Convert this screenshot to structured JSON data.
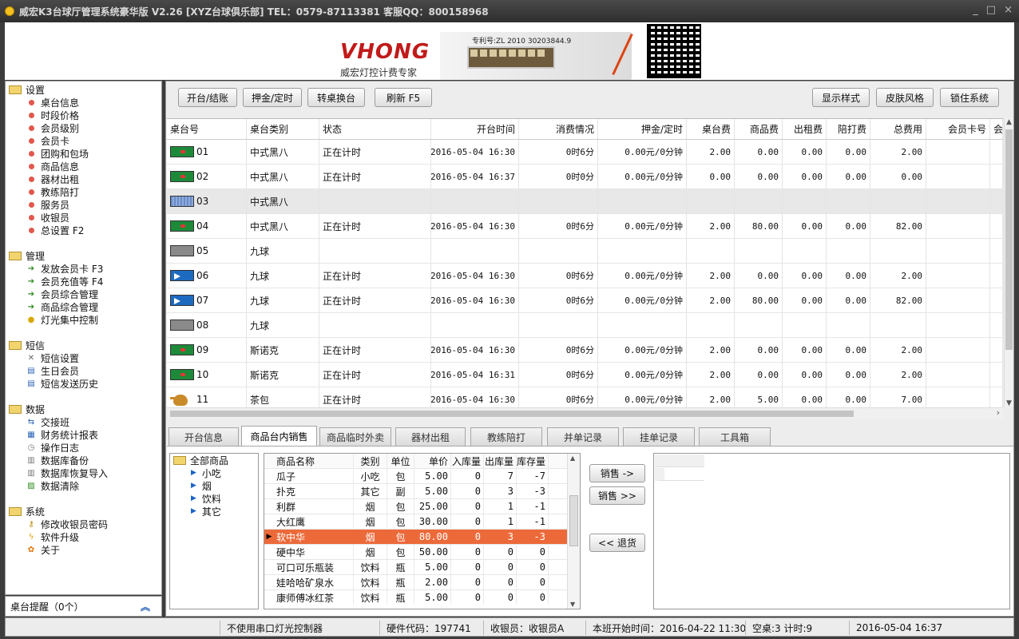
{
  "window": {
    "title": "威宏K3台球厅管理系统豪华版 V2.26   [XYZ台球俱乐部]   TEL：0579-87113381 客服QQ：800158968",
    "controls": [
      "_",
      "□",
      "×"
    ]
  },
  "banner": {
    "brand": "VHONG",
    "slogan": "威宏灯控计费专家",
    "patent": "专利号:ZL 2010 30203844.9"
  },
  "sidebar": {
    "groups": [
      {
        "title": "设置",
        "items": [
          {
            "label": "桌台信息",
            "icon": "dot-icon"
          },
          {
            "label": "时段价格",
            "icon": "dot-icon"
          },
          {
            "label": "会员级别",
            "icon": "dot-icon"
          },
          {
            "label": "会员卡",
            "icon": "dot-icon"
          },
          {
            "label": "团购和包场",
            "icon": "dot-icon"
          },
          {
            "label": "商品信息",
            "icon": "dot-icon"
          },
          {
            "label": "器材出租",
            "icon": "dot-icon"
          },
          {
            "label": "教练陪打",
            "icon": "dot-icon"
          },
          {
            "label": "服务员",
            "icon": "dot-icon"
          },
          {
            "label": "收银员",
            "icon": "dot-icon"
          },
          {
            "label": "总设置 F2",
            "icon": "dot-icon"
          }
        ]
      },
      {
        "title": "管理",
        "items": [
          {
            "label": "发放会员卡 F3",
            "icon": "arrow-icon"
          },
          {
            "label": "会员充值等 F4",
            "icon": "arrow-icon"
          },
          {
            "label": "会员综合管理",
            "icon": "arrow-icon"
          },
          {
            "label": "商品综合管理",
            "icon": "arrow-icon"
          },
          {
            "label": "灯光集中控制",
            "icon": "bulb-icon"
          }
        ]
      },
      {
        "title": "短信",
        "items": [
          {
            "label": "短信设置",
            "icon": "tools-icon"
          },
          {
            "label": "生日会员",
            "icon": "sms-icon"
          },
          {
            "label": "短信发送历史",
            "icon": "sms-icon"
          }
        ]
      },
      {
        "title": "数据",
        "items": [
          {
            "label": "交接班",
            "icon": "handover-icon"
          },
          {
            "label": "财务统计报表",
            "icon": "report-icon"
          },
          {
            "label": "操作日志",
            "icon": "clock-icon"
          },
          {
            "label": "数据库备份",
            "icon": "database-icon"
          },
          {
            "label": "数据库恢复导入",
            "icon": "database-icon"
          },
          {
            "label": "数据清除",
            "icon": "trash-icon"
          }
        ]
      },
      {
        "title": "系统",
        "items": [
          {
            "label": "修改收银员密码",
            "icon": "key-icon"
          },
          {
            "label": "软件升级",
            "icon": "bolt-icon"
          },
          {
            "label": "关于",
            "icon": "flower-icon"
          }
        ]
      }
    ],
    "reminder": "桌台提醒（0个）"
  },
  "toolbar": {
    "open_close": "开台/结账",
    "deposit": "押金/定时",
    "switch_table": "转桌换台",
    "refresh": "刷新 F5",
    "display_style": "显示样式",
    "skin": "皮肤风格",
    "lock": "锁住系统"
  },
  "tables": {
    "columns": [
      "桌台号",
      "桌台类别",
      "状态",
      "开台时间",
      "消费情况",
      "押金/定时",
      "桌台费",
      "商品费",
      "出租费",
      "陪打费",
      "总费用",
      "会员卡号",
      "会"
    ],
    "rows": [
      {
        "icon": "green",
        "no": "01",
        "type": "中式黑八",
        "status": "正在计时",
        "start": "2016-05-04 16:30",
        "usage": "0时6分",
        "deposit": "0.00元/0分钟",
        "table_fee": "2.00",
        "goods_fee": "0.00",
        "rent_fee": "0.00",
        "coach_fee": "0.00",
        "total": "2.00",
        "card": ""
      },
      {
        "icon": "green",
        "no": "02",
        "type": "中式黑八",
        "status": "正在计时",
        "start": "2016-05-04 16:37",
        "usage": "0时0分",
        "deposit": "0.00元/0分钟",
        "table_fee": "0.00",
        "goods_fee": "0.00",
        "rent_fee": "0.00",
        "coach_fee": "0.00",
        "total": "0.00",
        "card": ""
      },
      {
        "icon": "idle",
        "no": "03",
        "type": "中式黑八",
        "status": "",
        "start": "",
        "usage": "",
        "deposit": "",
        "table_fee": "",
        "goods_fee": "",
        "rent_fee": "",
        "coach_fee": "",
        "total": "",
        "card": ""
      },
      {
        "icon": "green",
        "no": "04",
        "type": "中式黑八",
        "status": "正在计时",
        "start": "2016-05-04 16:30",
        "usage": "0时6分",
        "deposit": "0.00元/0分钟",
        "table_fee": "2.00",
        "goods_fee": "80.00",
        "rent_fee": "0.00",
        "coach_fee": "0.00",
        "total": "82.00",
        "card": ""
      },
      {
        "icon": "grey",
        "no": "05",
        "type": "九球",
        "status": "",
        "start": "",
        "usage": "",
        "deposit": "",
        "table_fee": "",
        "goods_fee": "",
        "rent_fee": "",
        "coach_fee": "",
        "total": "",
        "card": ""
      },
      {
        "icon": "blue",
        "no": "06",
        "type": "九球",
        "status": "正在计时",
        "start": "2016-05-04 16:30",
        "usage": "0时6分",
        "deposit": "0.00元/0分钟",
        "table_fee": "2.00",
        "goods_fee": "0.00",
        "rent_fee": "0.00",
        "coach_fee": "0.00",
        "total": "2.00",
        "card": ""
      },
      {
        "icon": "blue",
        "no": "07",
        "type": "九球",
        "status": "正在计时",
        "start": "2016-05-04 16:30",
        "usage": "0时6分",
        "deposit": "0.00元/0分钟",
        "table_fee": "2.00",
        "goods_fee": "80.00",
        "rent_fee": "0.00",
        "coach_fee": "0.00",
        "total": "82.00",
        "card": ""
      },
      {
        "icon": "grey",
        "no": "08",
        "type": "九球",
        "status": "",
        "start": "",
        "usage": "",
        "deposit": "",
        "table_fee": "",
        "goods_fee": "",
        "rent_fee": "",
        "coach_fee": "",
        "total": "",
        "card": ""
      },
      {
        "icon": "green",
        "no": "09",
        "type": "斯诺克",
        "status": "正在计时",
        "start": "2016-05-04 16:30",
        "usage": "0时6分",
        "deposit": "0.00元/0分钟",
        "table_fee": "2.00",
        "goods_fee": "0.00",
        "rent_fee": "0.00",
        "coach_fee": "0.00",
        "total": "2.00",
        "card": ""
      },
      {
        "icon": "green",
        "no": "10",
        "type": "斯诺克",
        "status": "正在计时",
        "start": "2016-05-04 16:31",
        "usage": "0时6分",
        "deposit": "0.00元/0分钟",
        "table_fee": "2.00",
        "goods_fee": "0.00",
        "rent_fee": "0.00",
        "coach_fee": "0.00",
        "total": "2.00",
        "card": ""
      },
      {
        "icon": "teapot",
        "no": "11",
        "type": "茶包",
        "status": "正在计时",
        "start": "2016-05-04 16:30",
        "usage": "0时6分",
        "deposit": "0.00元/0分钟",
        "table_fee": "2.00",
        "goods_fee": "5.00",
        "rent_fee": "0.00",
        "coach_fee": "0.00",
        "total": "7.00",
        "card": ""
      }
    ],
    "selected_index": 2
  },
  "tabs": [
    {
      "label": "开台信息",
      "active": false
    },
    {
      "label": "商品台内销售",
      "active": true
    },
    {
      "label": "商品临时外卖",
      "active": false
    },
    {
      "label": "器材出租",
      "active": false
    },
    {
      "label": "教练陪打",
      "active": false
    },
    {
      "label": "并单记录",
      "active": false
    },
    {
      "label": "挂单记录",
      "active": false
    },
    {
      "label": "工具箱",
      "active": false
    }
  ],
  "categories": {
    "root": "全部商品",
    "items": [
      "小吃",
      "烟",
      "饮料",
      "其它"
    ]
  },
  "products": {
    "columns": [
      "商品名称",
      "类别",
      "单位",
      "单价",
      "入库量",
      "出库量",
      "库存量"
    ],
    "rows": [
      {
        "name": "瓜子",
        "cat": "小吃",
        "unit": "包",
        "price": "5.00",
        "in": "0",
        "out": "7",
        "stock": "-7"
      },
      {
        "name": "扑克",
        "cat": "其它",
        "unit": "副",
        "price": "5.00",
        "in": "0",
        "out": "3",
        "stock": "-3"
      },
      {
        "name": "利群",
        "cat": "烟",
        "unit": "包",
        "price": "25.00",
        "in": "0",
        "out": "1",
        "stock": "-1"
      },
      {
        "name": "大红鹰",
        "cat": "烟",
        "unit": "包",
        "price": "30.00",
        "in": "0",
        "out": "1",
        "stock": "-1"
      },
      {
        "name": "软中华",
        "cat": "烟",
        "unit": "包",
        "price": "80.00",
        "in": "0",
        "out": "3",
        "stock": "-3"
      },
      {
        "name": "硬中华",
        "cat": "烟",
        "unit": "包",
        "price": "50.00",
        "in": "0",
        "out": "0",
        "stock": "0"
      },
      {
        "name": "可口可乐瓶装",
        "cat": "饮料",
        "unit": "瓶",
        "price": "5.00",
        "in": "0",
        "out": "0",
        "stock": "0"
      },
      {
        "name": "娃哈哈矿泉水",
        "cat": "饮料",
        "unit": "瓶",
        "price": "2.00",
        "in": "0",
        "out": "0",
        "stock": "0"
      },
      {
        "name": "康师傅冰红茶",
        "cat": "饮料",
        "unit": "瓶",
        "price": "5.00",
        "in": "0",
        "out": "0",
        "stock": "0"
      }
    ],
    "selected_index": 4
  },
  "sale_buttons": {
    "sell": "销售 ->",
    "sell_more": "销售 >>",
    "return": "<< 退货"
  },
  "status": {
    "light_controller": "不使用串口灯光控制器",
    "hardware": "硬件代码：197741",
    "cashier": "收银员：收银员A",
    "shift_start": "本班开始时间：2016-04-22 11:30",
    "tables_state": "空桌:3 计时:9",
    "now": "2016-05-04 16:37"
  }
}
